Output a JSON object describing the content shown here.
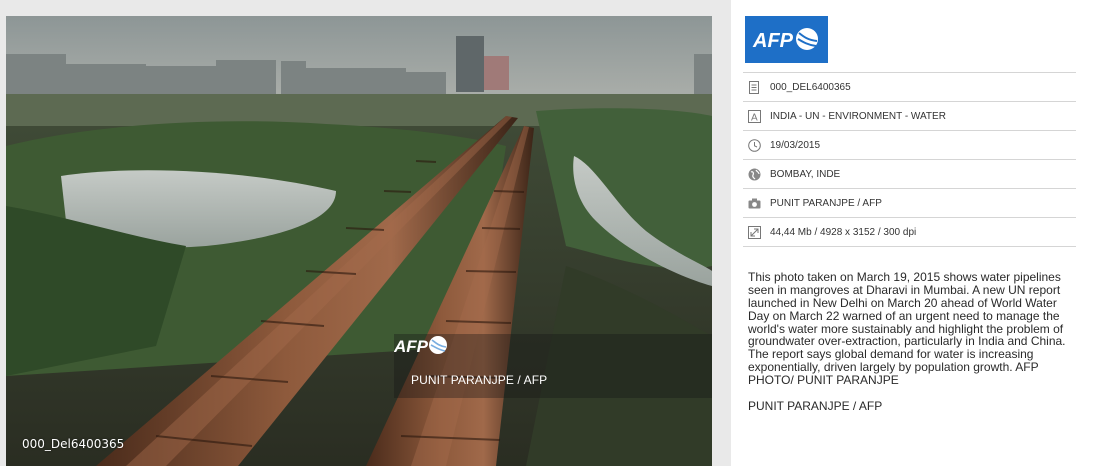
{
  "photo": {
    "watermark_logo": "AFP",
    "watermark_credit": "PUNIT PARANJPE / AFP",
    "photo_id": "000_Del6400365"
  },
  "panel": {
    "brand_logo": "AFP",
    "meta": [
      {
        "icon": "document-icon",
        "text": "000_DEL6400365"
      },
      {
        "icon": "text-a-icon",
        "text": "INDIA - UN - ENVIRONMENT - WATER"
      },
      {
        "icon": "clock-icon",
        "text": "19/03/2015"
      },
      {
        "icon": "globe-icon",
        "text": "BOMBAY, INDE"
      },
      {
        "icon": "camera-icon",
        "text": "PUNIT PARANJPE / AFP"
      },
      {
        "icon": "resize-icon",
        "text": "44,44 Mb / 4928 x 3152 / 300 dpi"
      }
    ],
    "caption": "This photo taken on March 19, 2015 shows water pipelines seen in mangroves at Dharavi in Mumbai. A new UN report launched in New Delhi on March 20 ahead of World Water Day on March 22 warned of an urgent need to manage the world's water more sustainably and highlight the problem of groundwater over-extraction, particularly in India and China. The report says global demand for water is increasing exponentially, driven largely by population growth. AFP PHOTO/ PUNIT PARANJPE",
    "caption_credit": "PUNIT PARANJPE / AFP"
  },
  "colors": {
    "afp_blue": "#1e6fc7",
    "divider": "#d5d5d5",
    "background": "#e9e9e9"
  }
}
